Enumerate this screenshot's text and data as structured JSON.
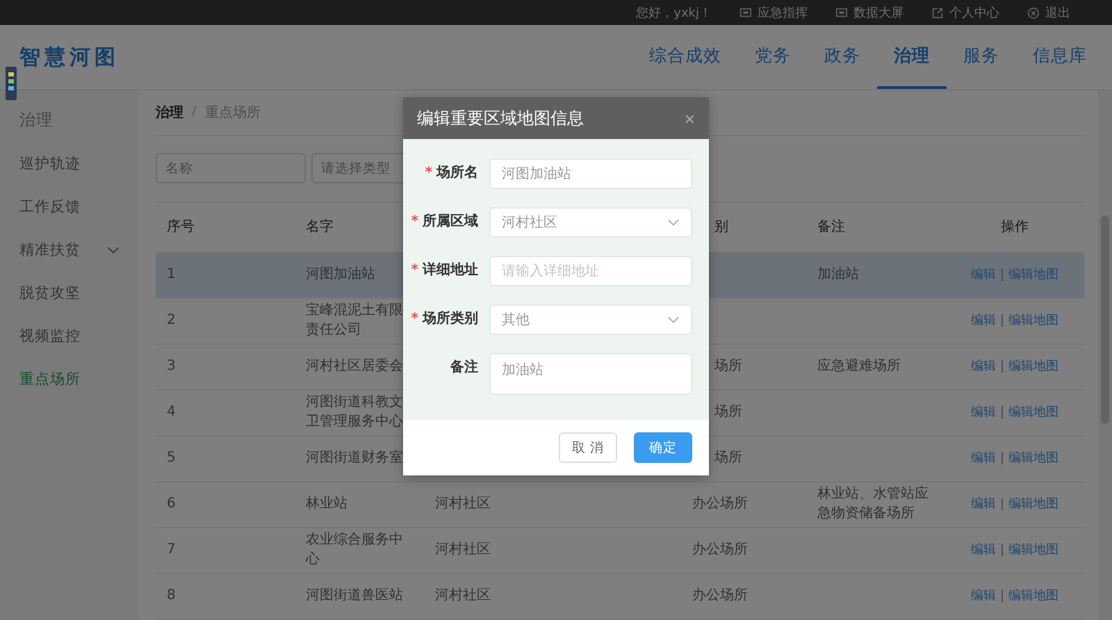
{
  "top_bar": {
    "greeting": "您好，yxkj！",
    "links": [
      {
        "label": "应急指挥",
        "kind": "screen"
      },
      {
        "label": "数据大屏",
        "kind": "screen"
      },
      {
        "label": "个人中心",
        "kind": "external"
      },
      {
        "label": "退出",
        "kind": "exit"
      }
    ]
  },
  "logo": "智慧河图",
  "nav": [
    {
      "label": "综合成效",
      "selected": false
    },
    {
      "label": "党务",
      "selected": false
    },
    {
      "label": "政务",
      "selected": false
    },
    {
      "label": "治理",
      "selected": true
    },
    {
      "label": "服务",
      "selected": false
    },
    {
      "label": "信息库",
      "selected": false
    }
  ],
  "sidebar": {
    "items": [
      {
        "label": "治理",
        "kind": "heading"
      },
      {
        "label": "巡护轨迹",
        "kind": "item",
        "selected": false
      },
      {
        "label": "工作反馈",
        "kind": "item",
        "selected": false
      },
      {
        "label": "精准扶贫",
        "kind": "submenu",
        "selected": false
      },
      {
        "label": "脱贫攻坚",
        "kind": "item",
        "selected": false
      },
      {
        "label": "视频监控",
        "kind": "item",
        "selected": false
      },
      {
        "label": "重点场所",
        "kind": "item",
        "selected": true
      }
    ]
  },
  "breadcrumb": [
    "治理",
    "/",
    "重点场所"
  ],
  "filters": [
    {
      "placeholder": "名称"
    },
    {
      "placeholder": "请选择类型"
    }
  ],
  "table": {
    "header": {
      "no": "序号",
      "name": "名字",
      "category": "别",
      "category_cut": true,
      "note": "备注",
      "actions": "操作"
    },
    "rows": [
      {
        "no": "1",
        "name": "河图加油站",
        "note": "加油站",
        "actions": [
          "编辑",
          "|",
          "编辑地图"
        ],
        "selected": true
      },
      {
        "no": "2",
        "name": "宝峰混泥土有限责任公司",
        "actions": [
          "编辑",
          "|",
          "编辑地图"
        ],
        "selected": false
      },
      {
        "no": "3",
        "name": "河村社区居委会",
        "category": "场所",
        "category_cut": true,
        "note": "应急避难场所",
        "actions": [
          "编辑",
          "|",
          "编辑地图"
        ],
        "selected": false
      },
      {
        "no": "4",
        "name": "河图街道科教文卫管理服务中心",
        "category": "场所",
        "category_cut": true,
        "actions": [
          "编辑",
          "|",
          "编辑地图"
        ],
        "selected": false
      },
      {
        "no": "5",
        "name": "河图街道财务室",
        "category": "场所",
        "category_cut": true,
        "actions": [
          "编辑",
          "|",
          "编辑地图"
        ],
        "selected": false
      },
      {
        "no": "6",
        "name": "林业站",
        "region": "河村社区",
        "category": "办公场所",
        "note": "林业站、水管站应急物资储备场所",
        "actions": [
          "编辑",
          "|",
          "编辑地图"
        ],
        "selected": false
      },
      {
        "no": "7",
        "name": "农业综合服务中心",
        "region": "河村社区",
        "category": "办公场所",
        "actions": [
          "编辑",
          "|",
          "编辑地图"
        ],
        "selected": false
      },
      {
        "no": "8",
        "name": "河图街道兽医站",
        "region": "河村社区",
        "category": "办公场所",
        "actions": [
          "编辑",
          "|",
          "编辑地图"
        ],
        "selected": false
      }
    ]
  },
  "dialog": {
    "title": "编辑重要区域地图信息",
    "close": "×",
    "fields": [
      {
        "label": "场所名",
        "required": "*",
        "kind": "input",
        "value": "河图加油站"
      },
      {
        "label": "所属区域",
        "required": "*",
        "kind": "select",
        "value": "河村社区"
      },
      {
        "label": "详细地址",
        "required": "*",
        "kind": "input",
        "placeholder": "请输入详细地址"
      },
      {
        "label": "场所类别",
        "required": "*",
        "kind": "select",
        "value": "其他"
      },
      {
        "label": "备注",
        "kind": "textarea",
        "value": "加油站"
      }
    ],
    "cancel": "取 消",
    "confirm": "确定"
  }
}
